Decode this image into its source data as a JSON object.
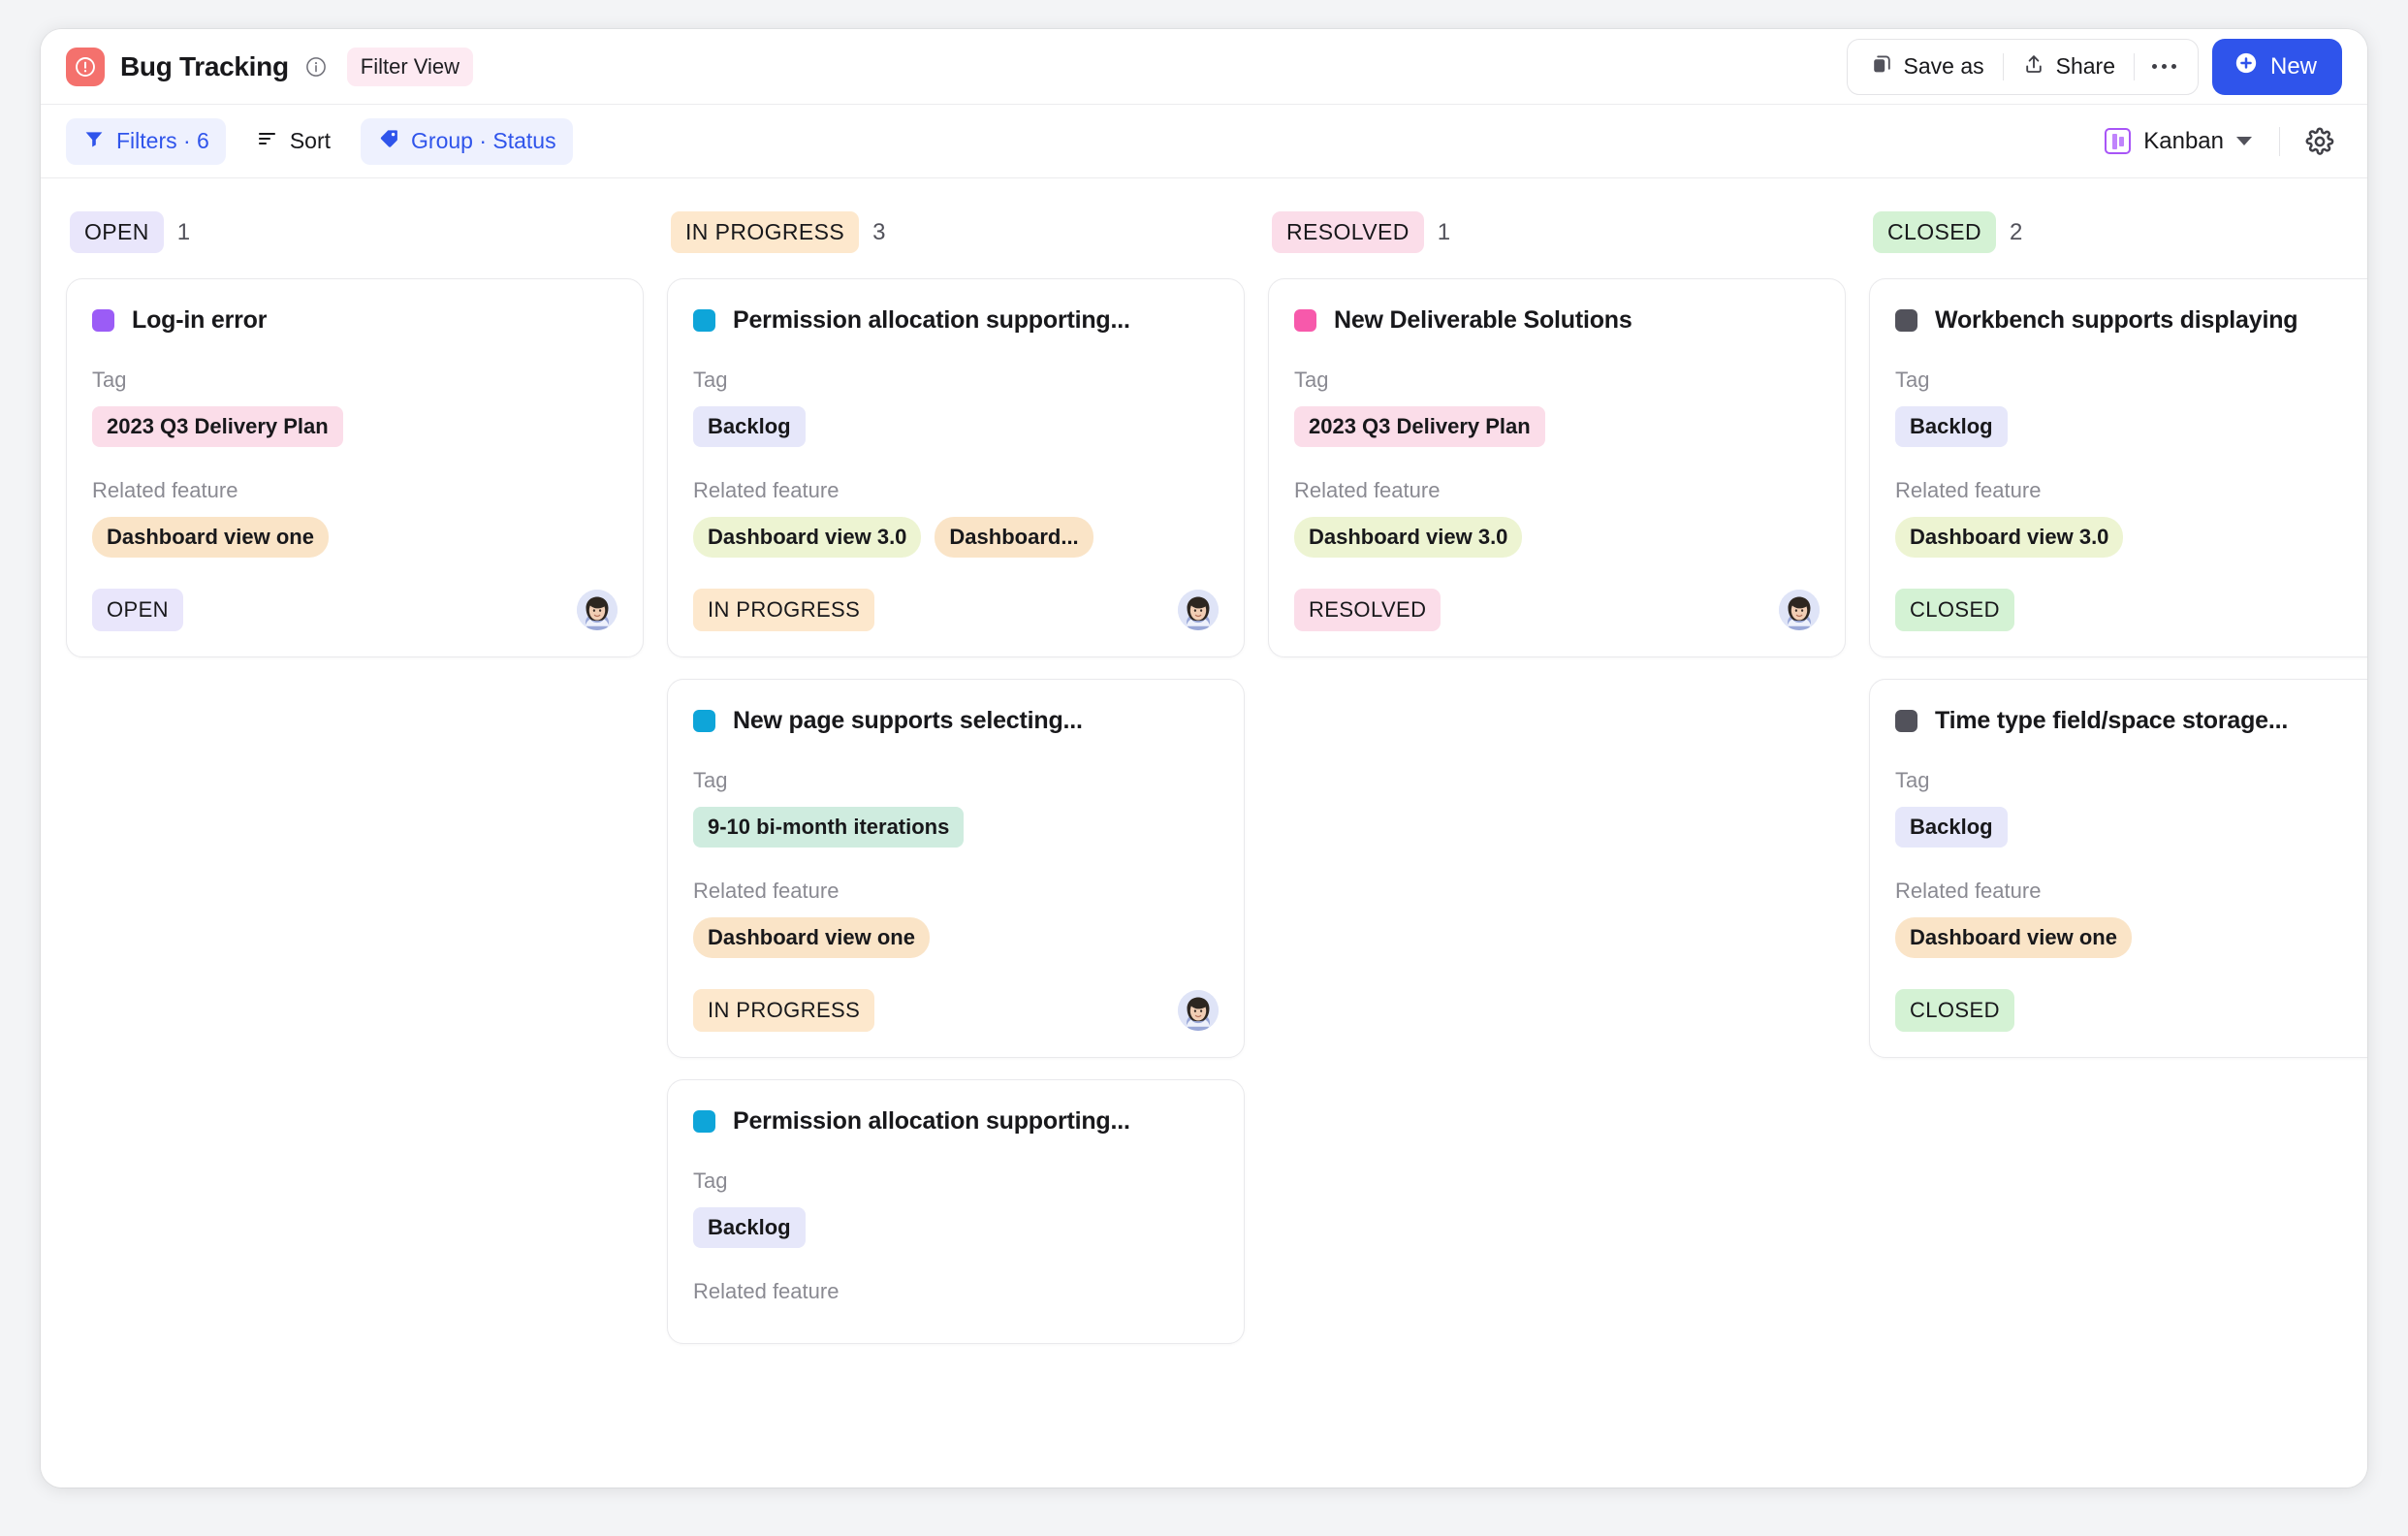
{
  "header": {
    "app_icon": "alert-circle-icon",
    "title": "Bug Tracking",
    "info_icon": "info-icon",
    "filter_view_badge": "Filter View",
    "save_as_label": "Save as",
    "save_as_icon": "copy-icon",
    "share_label": "Share",
    "share_icon": "share-icon",
    "more_icon": "ellipsis-icon",
    "new_label": "New",
    "new_icon": "plus-circle-icon",
    "accent_color": "#2f54eb",
    "app_icon_color": "#f4716d"
  },
  "toolbar": {
    "filters_label": "Filters · 6",
    "filters_icon": "funnel-icon",
    "sort_label": "Sort",
    "sort_icon": "sort-lines-icon",
    "group_label": "Group · Status",
    "group_icon": "tag-icon",
    "view_label": "Kanban",
    "view_icon": "kanban-icon",
    "view_chevron": "chevron-down-icon",
    "settings_icon": "gear-icon"
  },
  "board": {
    "columns": [
      {
        "name": "OPEN",
        "count": "1",
        "pill_bg": "#e9e6fb",
        "cards": [
          {
            "dot_color": "#9b5cf6",
            "title": "Log-in error",
            "tag_label": "Tag",
            "tags": [
              {
                "text": "2023 Q3 Delivery Plan",
                "bg": "#fbdde9",
                "shape": "square"
              }
            ],
            "feature_label": "Related feature",
            "features": [
              {
                "text": "Dashboard view one",
                "bg": "#fae4c7",
                "shape": "pill"
              }
            ],
            "status": "OPEN",
            "status_bg": "#e9e6fb",
            "avatar": "user-avatar"
          }
        ]
      },
      {
        "name": "IN PROGRESS",
        "count": "3",
        "pill_bg": "#fde8cd",
        "cards": [
          {
            "dot_color": "#0ea5d9",
            "title": "Permission allocation supporting...",
            "tag_label": "Tag",
            "tags": [
              {
                "text": "Backlog",
                "bg": "#e6e7fa",
                "shape": "square"
              }
            ],
            "feature_label": "Related feature",
            "features": [
              {
                "text": "Dashboard view 3.0",
                "bg": "#edf4d2",
                "shape": "pill"
              },
              {
                "text": "Dashboard...",
                "bg": "#fae4c7",
                "shape": "pill"
              }
            ],
            "status": "IN PROGRESS",
            "status_bg": "#fde8cd",
            "avatar": "user-avatar"
          },
          {
            "dot_color": "#0ea5d9",
            "title": "New page supports selecting...",
            "tag_label": "Tag",
            "tags": [
              {
                "text": "9-10 bi-month iterations",
                "bg": "#cfecdf",
                "shape": "square"
              }
            ],
            "feature_label": "Related feature",
            "features": [
              {
                "text": "Dashboard view one",
                "bg": "#fae4c7",
                "shape": "pill"
              }
            ],
            "status": "IN PROGRESS",
            "status_bg": "#fde8cd",
            "avatar": "user-avatar"
          },
          {
            "dot_color": "#0ea5d9",
            "title": "Permission allocation supporting...",
            "tag_label": "Tag",
            "tags": [
              {
                "text": "Backlog",
                "bg": "#e6e7fa",
                "shape": "square"
              }
            ],
            "feature_label": "Related feature",
            "features": [],
            "status": "",
            "status_bg": "",
            "avatar": ""
          }
        ]
      },
      {
        "name": "RESOLVED",
        "count": "1",
        "pill_bg": "#fbdde9",
        "cards": [
          {
            "dot_color": "#f759ab",
            "title": "New Deliverable Solutions",
            "tag_label": "Tag",
            "tags": [
              {
                "text": "2023 Q3 Delivery Plan",
                "bg": "#fbdde9",
                "shape": "square"
              }
            ],
            "feature_label": "Related feature",
            "features": [
              {
                "text": "Dashboard view 3.0",
                "bg": "#edf4d2",
                "shape": "pill"
              }
            ],
            "status": "RESOLVED",
            "status_bg": "#fbdde9",
            "avatar": "user-avatar"
          }
        ]
      },
      {
        "name": "CLOSED",
        "count": "2",
        "pill_bg": "#d4f2d4",
        "cards": [
          {
            "dot_color": "#52525b",
            "title": "Workbench supports displaying",
            "tag_label": "Tag",
            "tags": [
              {
                "text": "Backlog",
                "bg": "#e6e7fa",
                "shape": "square"
              }
            ],
            "feature_label": "Related feature",
            "features": [
              {
                "text": "Dashboard view 3.0",
                "bg": "#edf4d2",
                "shape": "pill"
              }
            ],
            "status": "CLOSED",
            "status_bg": "#d4f2d4",
            "avatar": ""
          },
          {
            "dot_color": "#52525b",
            "title": "Time type field/space storage...",
            "tag_label": "Tag",
            "tags": [
              {
                "text": "Backlog",
                "bg": "#e6e7fa",
                "shape": "square"
              }
            ],
            "feature_label": "Related feature",
            "features": [
              {
                "text": "Dashboard view one",
                "bg": "#fae4c7",
                "shape": "pill"
              }
            ],
            "status": "CLOSED",
            "status_bg": "#d4f2d4",
            "avatar": ""
          }
        ]
      }
    ]
  }
}
